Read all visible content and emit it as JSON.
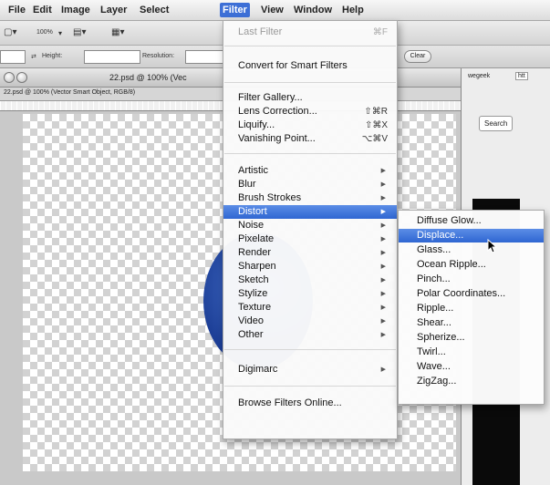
{
  "menubar": {
    "items": [
      "File",
      "Edit",
      "Image",
      "Layer",
      "Select",
      "Filter",
      "View",
      "Window",
      "Help"
    ],
    "active": "Filter"
  },
  "options_bar": {
    "zoom": "100%",
    "height_label": "Height:",
    "resolution_label": "Resolution:",
    "clear_label": "Clear"
  },
  "document": {
    "title": "22.psd @ 100% (Vec",
    "tab_label": "22.psd @ 100% (Vector Smart Object, RGB/8)",
    "browser_search": "Search",
    "browser_tab": "wegeek",
    "browser_tab2": "htt"
  },
  "filter_menu": {
    "last_filter": {
      "label": "Last Filter",
      "shortcut": "⌘F"
    },
    "convert": "Convert for Smart Filters",
    "group1": [
      {
        "label": "Filter Gallery...",
        "shortcut": ""
      },
      {
        "label": "Lens Correction...",
        "shortcut": "⇧⌘R"
      },
      {
        "label": "Liquify...",
        "shortcut": "⇧⌘X"
      },
      {
        "label": "Vanishing Point...",
        "shortcut": "⌥⌘V"
      }
    ],
    "submenus": [
      "Artistic",
      "Blur",
      "Brush Strokes",
      "Distort",
      "Noise",
      "Pixelate",
      "Render",
      "Sharpen",
      "Sketch",
      "Stylize",
      "Texture",
      "Video",
      "Other"
    ],
    "highlighted": "Distort",
    "digimarc": "Digimarc",
    "browse": "Browse Filters Online..."
  },
  "distort_submenu": {
    "items": [
      "Diffuse Glow...",
      "Displace...",
      "Glass...",
      "Ocean Ripple...",
      "Pinch...",
      "Polar Coordinates...",
      "Ripple...",
      "Shear...",
      "Spherize...",
      "Twirl...",
      "Wave...",
      "ZigZag..."
    ],
    "highlighted": "Displace..."
  },
  "colors": {
    "highlight": "#3d6fd6",
    "menu_bg": "#fafafa"
  }
}
